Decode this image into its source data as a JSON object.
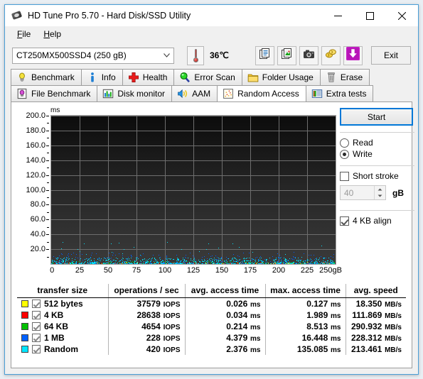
{
  "window": {
    "title": "HD Tune Pro 5.70 - Hard Disk/SSD Utility",
    "app_icon": "hard-disk-icon",
    "minimize_label": "–",
    "maximize_label": "□",
    "close_label": "✕"
  },
  "menu": {
    "items": [
      {
        "label": "File",
        "mnemonic": "F"
      },
      {
        "label": "Help",
        "mnemonic": "H"
      }
    ]
  },
  "toolbar": {
    "drive_selected": "CT250MX500SSD4 (250 gB)",
    "temperature": "36℃",
    "thermometer_icon": "thermometer-icon",
    "buttons": [
      {
        "name": "copy-text-button",
        "icon": "copy-text-icon",
        "tooltip": "Copy text"
      },
      {
        "name": "copy-image-button",
        "icon": "copy-image-icon",
        "tooltip": "Copy image"
      },
      {
        "name": "screenshot-button",
        "icon": "camera-icon",
        "tooltip": "Screenshot"
      },
      {
        "name": "donate-button",
        "icon": "coins-icon",
        "tooltip": "Donate"
      },
      {
        "name": "download-button",
        "icon": "download-arrow-icon",
        "tooltip": "Download"
      }
    ],
    "exit_label": "Exit"
  },
  "tabs": {
    "row1": [
      {
        "label": "Benchmark",
        "icon": "lightbulb-icon",
        "active": false
      },
      {
        "label": "Info",
        "icon": "info-icon",
        "active": false
      },
      {
        "label": "Health",
        "icon": "red-cross-icon",
        "active": false
      },
      {
        "label": "Error Scan",
        "icon": "magnifier-icon",
        "active": false
      },
      {
        "label": "Folder Usage",
        "icon": "folder-icon",
        "active": false
      },
      {
        "label": "Erase",
        "icon": "trash-icon",
        "active": false
      }
    ],
    "row2": [
      {
        "label": "File Benchmark",
        "icon": "file-bulb-icon",
        "active": false
      },
      {
        "label": "Disk monitor",
        "icon": "bar-graph-icon",
        "active": false
      },
      {
        "label": "AAM",
        "icon": "speaker-icon",
        "active": false
      },
      {
        "label": "Random Access",
        "icon": "scatter-icon",
        "active": true
      },
      {
        "label": "Extra tests",
        "icon": "chart-grid-icon",
        "active": false
      }
    ]
  },
  "controls": {
    "start_label": "Start",
    "mode_read_label": "Read",
    "mode_write_label": "Write",
    "mode_selected": "Write",
    "short_stroke_label": "Short stroke",
    "short_stroke_checked": false,
    "short_stroke_value": "40",
    "short_stroke_unit": "gB",
    "align_label": "4 KB align",
    "align_checked": true
  },
  "chart_data": {
    "type": "scatter",
    "title": "",
    "xlabel": "250gB",
    "ylabel": "ms",
    "x_unit_suffix": "gB",
    "xlim": [
      0,
      250
    ],
    "ylim": [
      0,
      200
    ],
    "xticks": [
      0,
      25,
      50,
      75,
      100,
      125,
      150,
      175,
      200,
      225,
      250
    ],
    "xticklabels": [
      "0",
      "25",
      "50",
      "75",
      "100",
      "125",
      "150",
      "175",
      "200",
      "225",
      "250gB"
    ],
    "yticks": [
      20.0,
      40.0,
      60.0,
      80.0,
      100.0,
      120.0,
      140.0,
      160.0,
      180.0,
      200.0
    ],
    "yticklabels": [
      "20.0",
      "40.0",
      "60.0",
      "80.0",
      "100.0",
      "120.0",
      "140.0",
      "160.0",
      "180.0",
      "200.0"
    ],
    "grid": true,
    "plot_background": "#1a1a1a",
    "grid_color": "#6e6e6e",
    "series": [
      {
        "name": "512 bytes",
        "color": "#ffff00",
        "point_count": 260,
        "band_ms": [
          0.0,
          2.5
        ]
      },
      {
        "name": "4 KB",
        "color": "#ff0000",
        "point_count": 180,
        "band_ms": [
          0.0,
          2.5
        ]
      },
      {
        "name": "64 KB",
        "color": "#00c000",
        "point_count": 260,
        "band_ms": [
          0.0,
          4.0
        ]
      },
      {
        "name": "1 MB",
        "color": "#0060ff",
        "point_count": 330,
        "band_ms": [
          1.0,
          16.0
        ]
      },
      {
        "name": "Random",
        "color": "#00e5ff",
        "point_count": 1300,
        "band_ms": [
          0.0,
          9.0
        ]
      }
    ]
  },
  "results": {
    "columns": [
      "transfer size",
      "operations / sec",
      "avg. access time",
      "max. access time",
      "avg. speed"
    ],
    "rows": [
      {
        "color": "#ffff00",
        "checked": true,
        "transfer_size": "512 bytes",
        "ops": "37579",
        "ops_unit": "IOPS",
        "avg_access": "0.026",
        "avg_access_unit": "ms",
        "max_access": "0.127",
        "max_access_unit": "ms",
        "avg_speed": "18.350",
        "avg_speed_unit": "MB/s"
      },
      {
        "color": "#ff0000",
        "checked": true,
        "transfer_size": "4 KB",
        "ops": "28638",
        "ops_unit": "IOPS",
        "avg_access": "0.034",
        "avg_access_unit": "ms",
        "max_access": "1.989",
        "max_access_unit": "ms",
        "avg_speed": "111.869",
        "avg_speed_unit": "MB/s"
      },
      {
        "color": "#00c000",
        "checked": true,
        "transfer_size": "64 KB",
        "ops": "4654",
        "ops_unit": "IOPS",
        "avg_access": "0.214",
        "avg_access_unit": "ms",
        "max_access": "8.513",
        "max_access_unit": "ms",
        "avg_speed": "290.932",
        "avg_speed_unit": "MB/s"
      },
      {
        "color": "#0060ff",
        "checked": true,
        "transfer_size": "1 MB",
        "ops": "228",
        "ops_unit": "IOPS",
        "avg_access": "4.379",
        "avg_access_unit": "ms",
        "max_access": "16.448",
        "max_access_unit": "ms",
        "avg_speed": "228.312",
        "avg_speed_unit": "MB/s"
      },
      {
        "color": "#00e5ff",
        "checked": true,
        "transfer_size": "Random",
        "ops": "420",
        "ops_unit": "IOPS",
        "avg_access": "2.376",
        "avg_access_unit": "ms",
        "max_access": "135.085",
        "max_access_unit": "ms",
        "avg_speed": "213.461",
        "avg_speed_unit": "MB/s"
      }
    ]
  }
}
